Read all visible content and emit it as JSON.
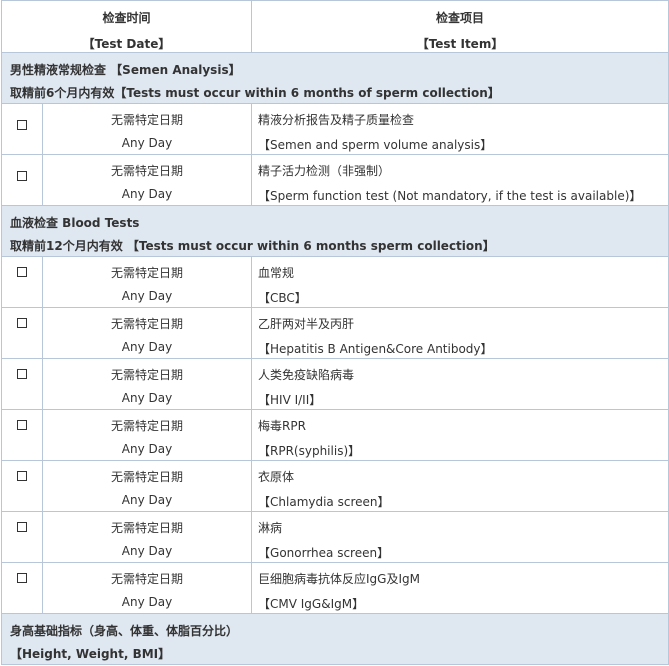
{
  "header": {
    "date_zh": "检查时间",
    "date_en": "【Test Date】",
    "item_zh": "检查项目",
    "item_en": "【Test Item】"
  },
  "semen": {
    "title": "男性精液常规检查 【Semen Analysis】",
    "note": "取精前6个月内有效【Tests must occur within 6  months of sperm collection】",
    "rows": [
      {
        "checkbox": "☐",
        "date_zh": "无需特定日期",
        "date_en": "Any  Day",
        "item_zh": "精液分析报告及精子质量检查",
        "item_en": "【Semen and sperm volume  analysis】"
      },
      {
        "checkbox": "☐",
        "date_zh": "无需特定日期",
        "date_en": "Any  Day",
        "item_zh": "精子活力检测（非强制）",
        "item_en": "【Sperm function test (Not  mandatory, if the test is available)】"
      }
    ]
  },
  "blood": {
    "title": "血液检查 Blood Tests",
    "note": "取精前12个月内有效 【Tests must occur within 6 months sperm collection】",
    "rows": [
      {
        "checkbox": "☐",
        "date_zh": "无需特定日期",
        "date_en": "Any  Day",
        "item_zh": "血常规",
        "item_en": "【CBC】"
      },
      {
        "checkbox": "☐",
        "date_zh": "无需特定日期",
        "date_en": "Any  Day",
        "item_zh": "乙肝两对半及丙肝",
        "item_en": "【Hepatitis B Antigen&Core  Antibody】"
      },
      {
        "checkbox": "☐",
        "date_zh": "无需特定日期",
        "date_en": "Any  Day",
        "item_zh": "人类免疫缺陷病毒",
        "item_en": "【HIV I/II】"
      },
      {
        "checkbox": "☐",
        "date_zh": "无需特定日期",
        "date_en": "Any  Day",
        "item_zh": "梅毒RPR",
        "item_en": "【RPR(syphilis)】"
      },
      {
        "checkbox": "☐",
        "date_zh": "无需特定日期",
        "date_en": "Any  Day",
        "item_zh": "衣原体",
        "item_en": "【Chlamydia screen】"
      },
      {
        "checkbox": "☐",
        "date_zh": "无需特定日期",
        "date_en": "Any  Day",
        "item_zh": "淋病",
        "item_en": "【Gonorrhea screen】"
      },
      {
        "checkbox": "☐",
        "date_zh": "无需特定日期",
        "date_en": "Any  Day",
        "item_zh": "巨细胞病毒抗体反应IgG及IgM",
        "item_en": "【CMV IgG&IgM】"
      }
    ]
  },
  "body_metrics": {
    "title": "身高基础指标（身高、体重、体脂百分比）",
    "note": "【Height, Weight, BMI】"
  }
}
